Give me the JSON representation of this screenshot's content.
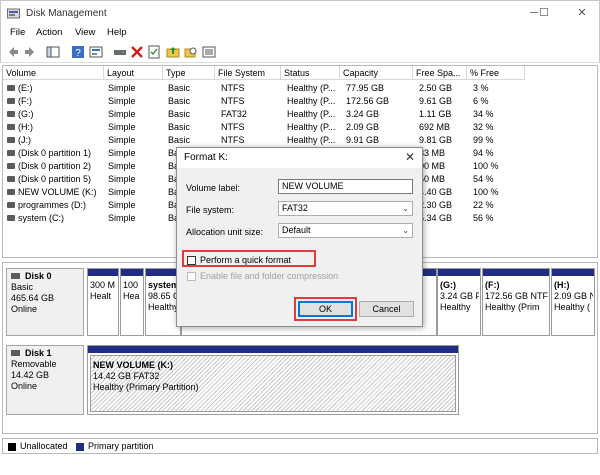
{
  "window": {
    "title": "Disk Management",
    "minimize": "─",
    "maximize": "☐",
    "close": "✕"
  },
  "menu": [
    "File",
    "Action",
    "View",
    "Help"
  ],
  "toolbar_icons": [
    "back-icon",
    "forward-icon",
    "console-tree-icon",
    "help-icon",
    "properties-icon",
    "connect-drive-icon",
    "delete-icon",
    "check-icon",
    "folder-up-icon",
    "folder-search-icon",
    "volume-list-icon"
  ],
  "volume_table": {
    "columns": [
      "Volume",
      "Layout",
      "Type",
      "File System",
      "Status",
      "Capacity",
      "Free Spa...",
      "% Free"
    ],
    "rows": [
      [
        "(E:)",
        "Simple",
        "Basic",
        "NTFS",
        "Healthy (P...",
        "77.95 GB",
        "2.50 GB",
        "3 %"
      ],
      [
        "(F:)",
        "Simple",
        "Basic",
        "NTFS",
        "Healthy (P...",
        "172.56 GB",
        "9.61 GB",
        "6 %"
      ],
      [
        "(G:)",
        "Simple",
        "Basic",
        "FAT32",
        "Healthy (P...",
        "3.24 GB",
        "1.11 GB",
        "34 %"
      ],
      [
        "(H:)",
        "Simple",
        "Basic",
        "NTFS",
        "Healthy (P...",
        "2.09 GB",
        "692 MB",
        "32 %"
      ],
      [
        "(J:)",
        "Simple",
        "Basic",
        "NTFS",
        "Healthy (P...",
        "9.91 GB",
        "9.81 GB",
        "99 %"
      ],
      [
        "(Disk 0 partition 1)",
        "Simple",
        "Ba",
        "",
        "",
        "",
        "83 MB",
        "94 %"
      ],
      [
        "(Disk 0 partition 2)",
        "Simple",
        "Ba",
        "",
        "",
        "",
        "00 MB",
        "100 %"
      ],
      [
        "(Disk 0 partition 5)",
        "Simple",
        "Ba",
        "",
        "",
        "",
        "50 MB",
        "54 %"
      ],
      [
        "NEW VOLUME (K:)",
        "Simple",
        "Ba",
        "",
        "",
        "",
        "4.40 GB",
        "100 %"
      ],
      [
        "programmes (D:)",
        "Simple",
        "Ba",
        "",
        "",
        "",
        "2.30 GB",
        "22 %"
      ],
      [
        "system (C:)",
        "Simple",
        "Ba",
        "",
        "",
        "",
        "5.34 GB",
        "56 %"
      ]
    ]
  },
  "disks": {
    "disk0": {
      "name": "Disk 0",
      "type": "Basic",
      "size": "465.64 GB",
      "status": "Online"
    },
    "disk1": {
      "name": "Disk 1",
      "type": "Removable",
      "size": "14.42 GB",
      "status": "Online"
    },
    "disk0_parts": [
      {
        "label": "",
        "l1": "300 M",
        "l2": "Healt"
      },
      {
        "label": "",
        "l1": "100",
        "l2": "Hea"
      },
      {
        "label": "system",
        "l1": "98.65 G",
        "l2": "Healthy"
      },
      {
        "label": "(G:)",
        "l1": "3.24 GB F",
        "l2": "Healthy"
      },
      {
        "label": "(F:)",
        "l1": "172.56 GB NTF",
        "l2": "Healthy (Prim"
      },
      {
        "label": "(H:)",
        "l1": "2.09 GB NT",
        "l2": "Healthy ("
      }
    ],
    "disk1_part": {
      "label": "NEW VOLUME  (K:)",
      "l1": "14.42 GB FAT32",
      "l2": "Healthy (Primary Partition)"
    }
  },
  "legend": {
    "unallocated": "Unallocated",
    "primary": "Primary partition"
  },
  "dialog": {
    "title": "Format K:",
    "volume_label_caption": "Volume label:",
    "volume_label_value": "NEW VOLUME",
    "file_system_caption": "File system:",
    "file_system_value": "FAT32",
    "alloc_caption": "Allocation unit size:",
    "alloc_value": "Default",
    "quick_format": "Perform a quick format",
    "compression": "Enable file and folder compression",
    "ok": "OK",
    "cancel": "Cancel"
  },
  "colors": {
    "primary_partition": "#1f2d86",
    "highlight": "#e23b3b",
    "unallocated": "#000000"
  }
}
